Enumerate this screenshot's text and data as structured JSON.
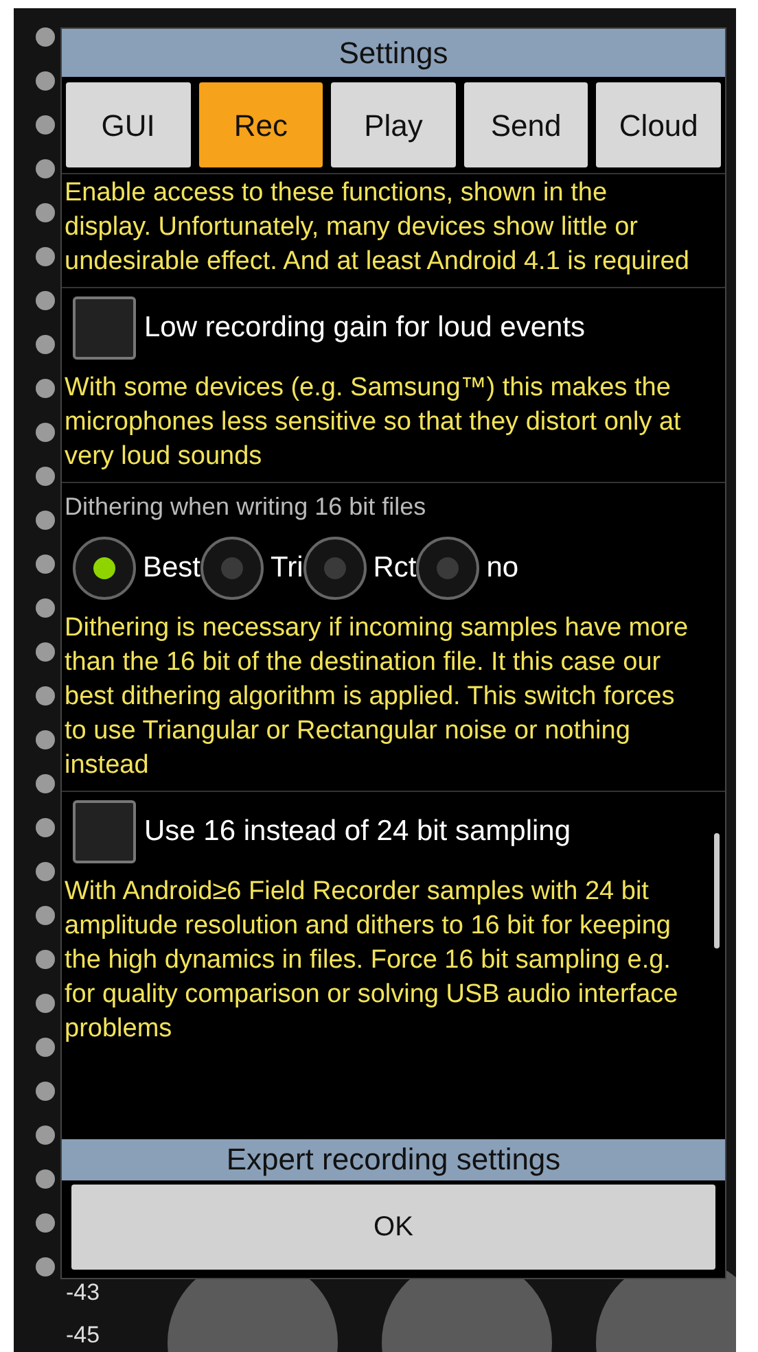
{
  "dialog": {
    "title": "Settings",
    "tabs": [
      {
        "label": "GUI",
        "selected": false
      },
      {
        "label": "Rec",
        "selected": true
      },
      {
        "label": "Play",
        "selected": false
      },
      {
        "label": "Send",
        "selected": false
      },
      {
        "label": "Cloud",
        "selected": false
      }
    ],
    "sections": [
      {
        "kind": "text",
        "text": "Enable access to these functions, shown in the display. Unfortunately, many devices show little or undesirable effect. And at least Android 4.1 is required"
      },
      {
        "kind": "checkbox",
        "label": "Low recording gain for loud events",
        "checked": false
      },
      {
        "kind": "text",
        "text": "With some devices (e.g. Samsung™) this makes the microphones less sensitive so that they distort only at very loud sounds"
      },
      {
        "kind": "radio",
        "label": "Dithering when writing 16 bit files",
        "options": [
          {
            "label": "Best",
            "selected": true
          },
          {
            "label": "Tri",
            "selected": false
          },
          {
            "label": "Rct",
            "selected": false
          },
          {
            "label": "no",
            "selected": false
          }
        ]
      },
      {
        "kind": "text",
        "text": "Dithering is necessary if incoming samples have more than the 16 bit of the destination file. It this case our best dithering algorithm is applied. This switch forces to use Triangular or Rectangular noise or nothing instead"
      },
      {
        "kind": "checkbox",
        "label": "Use 16 instead of 24 bit sampling",
        "checked": false
      },
      {
        "kind": "text",
        "text": "With Android≥6 Field Recorder samples with 24 bit amplitude resolution and dithers to 16 bit for keeping the high dynamics in files. Force 16 bit sampling e.g. for quality comparison or solving USB audio interface problems"
      }
    ],
    "next_section": "Expert recording settings",
    "ok_button": "OK"
  },
  "background": {
    "scale_labels": [
      "-43",
      "-45"
    ]
  }
}
